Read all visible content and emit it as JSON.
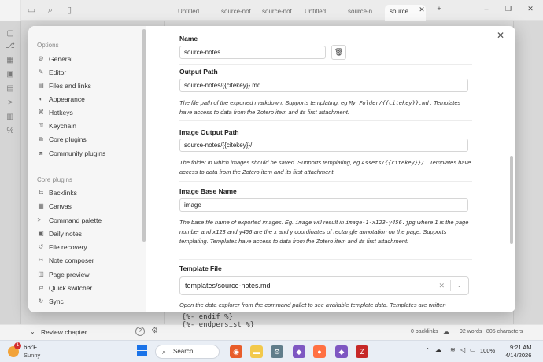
{
  "tabs": [
    "Untitled",
    "source-not...",
    "source-not...",
    "Untitled",
    "source-n...",
    "source..."
  ],
  "window_controls": {
    "minimize": "–",
    "restore": "❐",
    "close": "✕"
  },
  "new_tab": "+",
  "background": {
    "line1": "{%- endif %}",
    "line2": "{%- endpersist %}",
    "sidebar_footer": "Review chapter",
    "status_backlinks": "0 backlinks",
    "status_words": "92 words",
    "status_chars": "805 characters"
  },
  "settings_nav": {
    "options_header": "Options",
    "options": [
      {
        "label": "General",
        "icon": "⚙"
      },
      {
        "label": "Editor",
        "icon": "✎"
      },
      {
        "label": "Files and links",
        "icon": "▤"
      },
      {
        "label": "Appearance",
        "icon": "◐"
      },
      {
        "label": "Hotkeys",
        "icon": "⌘"
      },
      {
        "label": "Keychain",
        "icon": "⚿"
      },
      {
        "label": "Core plugins",
        "icon": "⧉"
      },
      {
        "label": "Community plugins",
        "icon": "⧈"
      }
    ],
    "core_header": "Core plugins",
    "core": [
      {
        "label": "Backlinks",
        "icon": "⇆"
      },
      {
        "label": "Canvas",
        "icon": "▦"
      },
      {
        "label": "Command palette",
        "icon": ">_"
      },
      {
        "label": "Daily notes",
        "icon": "▣"
      },
      {
        "label": "File recovery",
        "icon": "↺"
      },
      {
        "label": "Note composer",
        "icon": "✂"
      },
      {
        "label": "Page preview",
        "icon": "◫"
      },
      {
        "label": "Quick switcher",
        "icon": "⇄"
      },
      {
        "label": "Sync",
        "icon": "↻"
      }
    ]
  },
  "settings": {
    "name_title": "Name",
    "name_value": "source-notes",
    "output_title": "Output Path",
    "output_value": "source-notes/{{citekey}}.md",
    "output_desc_a": "The file path of the exported markdown. Supports templating, eg",
    "output_desc_code": "My Folder/{{citekey}}.md",
    "output_desc_b": ". Templates have access to data from the Zotero item and its first attachment.",
    "image_out_title": "Image Output Path",
    "image_out_value": "source-notes/{{citekey}}/",
    "image_out_desc_a": "The folder in which images should be saved. Supports templating, eg",
    "image_out_desc_code": "Assets/{{citekey}}/",
    "image_out_desc_b": ". Templates have access to data from the Zotero item and its first attachment.",
    "image_base_title": "Image Base Name",
    "image_base_value": "image",
    "image_base_desc_1": "The base file name of exported images. Eg.",
    "image_base_desc_c1": "image",
    "image_base_desc_2": "will result in",
    "image_base_desc_c2": "image-1-x123-y456.jpg",
    "image_base_desc_3": "where",
    "image_base_desc_c3": "1",
    "image_base_desc_4": "is the page number and",
    "image_base_desc_c4": "x123",
    "image_base_desc_5": "and",
    "image_base_desc_c5": "y456",
    "image_base_desc_6": "are the x and y coordinates of rectangle annotation on the page. Supports templating. Templates have access to data from the Zotero item and its first attachment.",
    "template_title": "Template File",
    "template_value": "templates/source-notes.md",
    "template_desc": "Open the data explorer from the command pallet to see available template data. Templates are written"
  },
  "taskbar": {
    "weather_temp": "66°F",
    "weather_text": "Sunny",
    "weather_badge": "1",
    "search_label": "Search",
    "battery": "100%",
    "time": "9:21 AM",
    "date": "4/14/2026"
  }
}
